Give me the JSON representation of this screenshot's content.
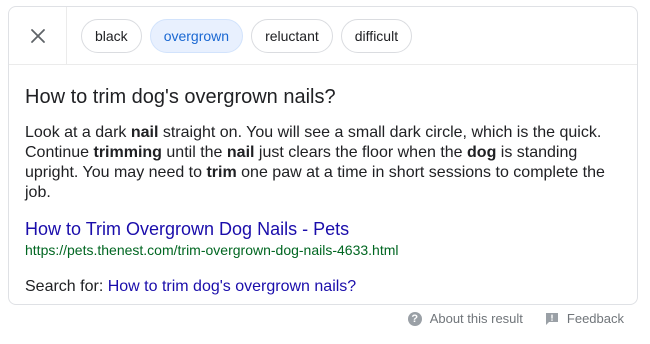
{
  "chips": [
    "black",
    "overgrown",
    "reluctant",
    "difficult"
  ],
  "selected_chip": "overgrown",
  "question": "How to trim dog's overgrown nails?",
  "answer": {
    "s1": "Look at a dark ",
    "b1": "nail",
    "s2": " straight on. You will see a small dark circle, which is the quick. Continue ",
    "b2": "trimming",
    "s3": " until the ",
    "b3": "nail",
    "s4": " just clears the floor when the ",
    "b4": "dog",
    "s5": " is standing upright. You may need to ",
    "b5": "trim",
    "s6": " one paw at a time in short sessions to complete the job."
  },
  "source": {
    "title": "How to Trim Overgrown Dog Nails - Pets",
    "url": "https://pets.thenest.com/trim-overgrown-dog-nails-4633.html"
  },
  "search_for": {
    "label": "Search for: ",
    "query": "How to trim dog's overgrown nails?"
  },
  "footer": {
    "about": "About this result",
    "feedback": "Feedback"
  },
  "icons": [
    "close-icon",
    "help-icon",
    "feedback-icon"
  ]
}
